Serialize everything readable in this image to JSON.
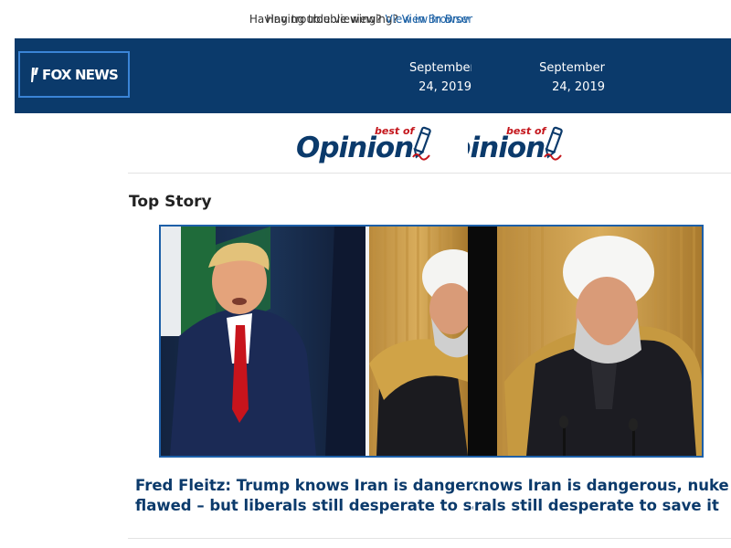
{
  "trouble_bar": {
    "prompt": "Having trouble viewing?",
    "link": "View in Browser"
  },
  "header": {
    "logo_text": "FOX NEWS",
    "date": "September 24, 2019"
  },
  "opinion_banner": {
    "word": "Opinion",
    "best_of": "best of"
  },
  "top_story": {
    "section_title": "Top Story",
    "headline_line1": "Fred Fleitz: Trump knows Iran is dangerous, nuke deal is",
    "headline_line2": "flawed – but liberals still desperate to save it"
  },
  "colors": {
    "header_bg": "#0b3a6b",
    "logo_border": "#3a84d6",
    "link": "#1f63a6",
    "headline": "#0b3a6b",
    "accent_red": "#c4161c"
  },
  "icons": [
    "fox-news-logo",
    "opinion-pen-icon"
  ]
}
